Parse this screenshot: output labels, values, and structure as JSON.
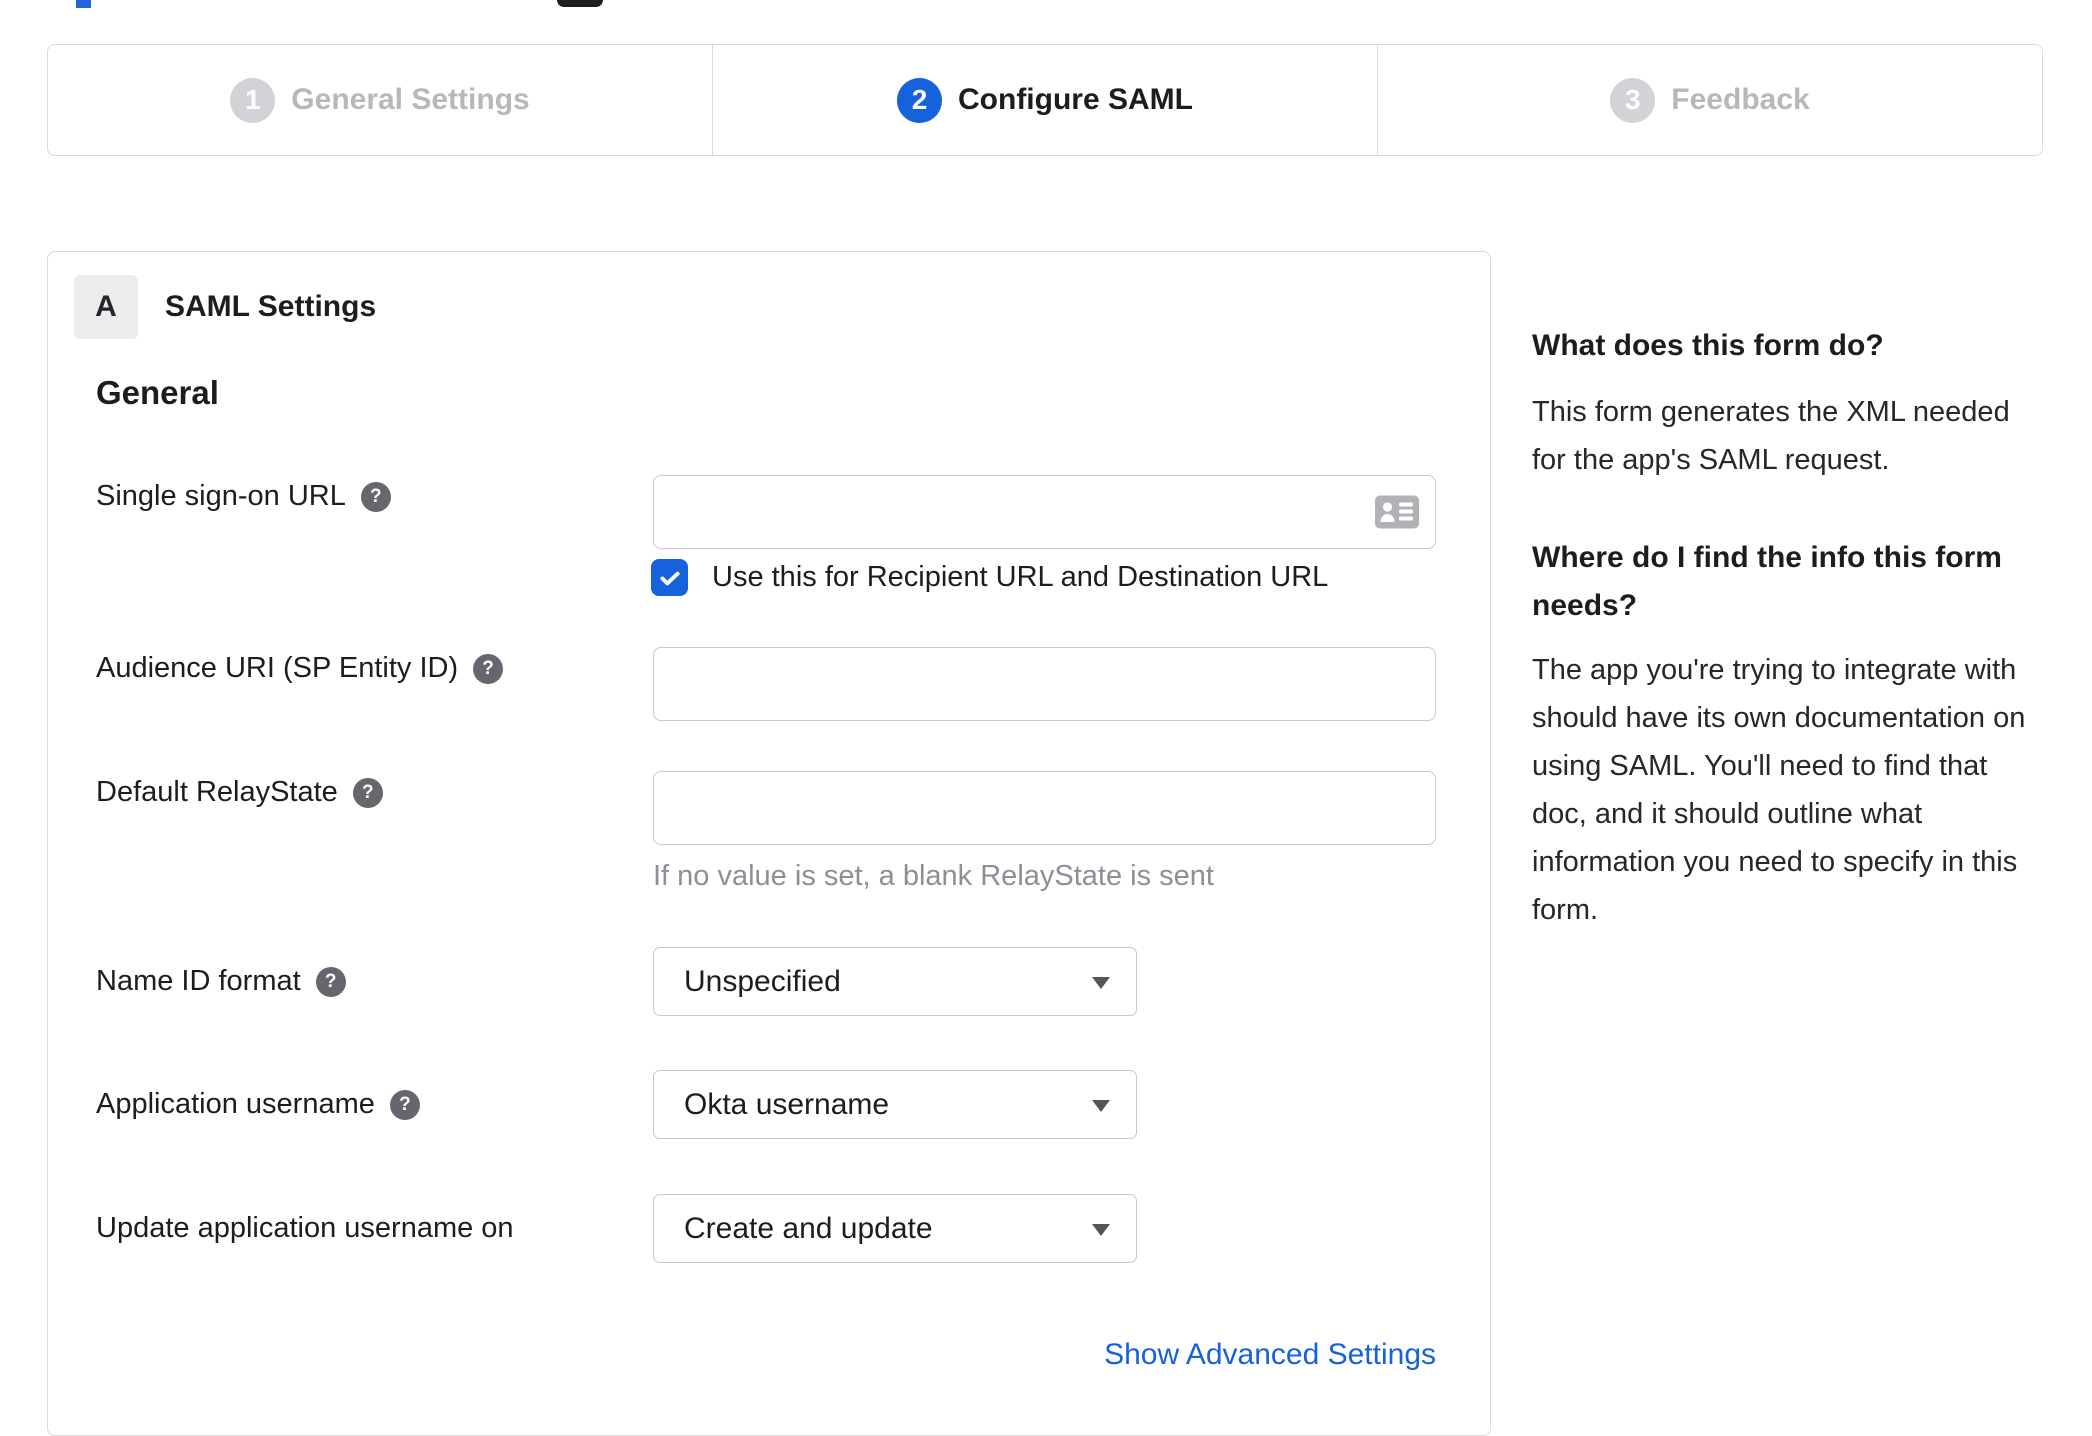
{
  "stepper": {
    "steps": [
      {
        "number": "1",
        "label": "General Settings",
        "state": "inactive"
      },
      {
        "number": "2",
        "label": "Configure SAML",
        "state": "active"
      },
      {
        "number": "3",
        "label": "Feedback",
        "state": "inactive"
      }
    ]
  },
  "panel": {
    "badge": "A",
    "title": "SAML Settings",
    "section_heading": "General",
    "fields": {
      "sso": {
        "label": "Single sign-on URL",
        "value": "",
        "checkbox_label": "Use this for Recipient URL and Destination URL",
        "checked": true
      },
      "audience": {
        "label": "Audience URI (SP Entity ID)",
        "value": ""
      },
      "relay": {
        "label": "Default RelayState",
        "value": "",
        "hint": "If no value is set, a blank RelayState is sent"
      },
      "name_id": {
        "label": "Name ID format",
        "value": "Unspecified"
      },
      "app_username": {
        "label": "Application username",
        "value": "Okta username"
      },
      "update_on": {
        "label": "Update application username on",
        "value": "Create and update"
      }
    },
    "advanced_link": "Show Advanced Settings"
  },
  "sidebar": {
    "q1": "What does this form do?",
    "a1": "This form generates the XML needed for the app's SAML request.",
    "q2": "Where do I find the info this form needs?",
    "a2": "The app you're trying to integrate with should have its own documentation on using SAML. You'll need to find that doc, and it should outline what information you need to specify in this form."
  },
  "icons": {
    "help": "?",
    "contact_card": "contact-card-icon",
    "dropdown_arrow": "chevron-down-icon"
  },
  "colors": {
    "accent": "#1662dd",
    "inactive_gray": "#d2d2d7",
    "border": "#d9d9dd",
    "hint_text": "#8e8e96"
  }
}
